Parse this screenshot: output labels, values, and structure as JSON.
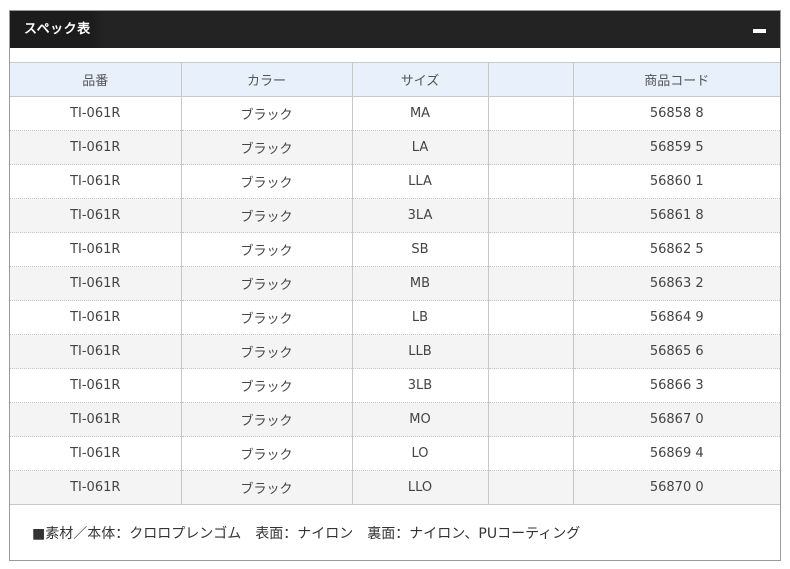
{
  "panel": {
    "title": "スペック表",
    "collapse_icon": "minus-icon"
  },
  "table": {
    "headers": [
      "品番",
      "カラー",
      "サイズ",
      "",
      "商品コード"
    ],
    "rows": [
      [
        "TI-061R",
        "ブラック",
        "MA",
        "",
        "56858 8"
      ],
      [
        "TI-061R",
        "ブラック",
        "LA",
        "",
        "56859 5"
      ],
      [
        "TI-061R",
        "ブラック",
        "LLA",
        "",
        "56860 1"
      ],
      [
        "TI-061R",
        "ブラック",
        "3LA",
        "",
        "56861 8"
      ],
      [
        "TI-061R",
        "ブラック",
        "SB",
        "",
        "56862 5"
      ],
      [
        "TI-061R",
        "ブラック",
        "MB",
        "",
        "56863 2"
      ],
      [
        "TI-061R",
        "ブラック",
        "LB",
        "",
        "56864 9"
      ],
      [
        "TI-061R",
        "ブラック",
        "LLB",
        "",
        "56865 6"
      ],
      [
        "TI-061R",
        "ブラック",
        "3LB",
        "",
        "56866 3"
      ],
      [
        "TI-061R",
        "ブラック",
        "MO",
        "",
        "56867 0"
      ],
      [
        "TI-061R",
        "ブラック",
        "LO",
        "",
        "56869 4"
      ],
      [
        "TI-061R",
        "ブラック",
        "LLO",
        "",
        "56870 0"
      ]
    ]
  },
  "note": "■素材／本体：クロロプレンゴム　表面：ナイロン　裏面：ナイロン、PUコーティング",
  "colors": {
    "header_bg": "#232323",
    "table_header_bg": "#e8f0fb",
    "alt_row_bg": "#f4f4f4"
  }
}
